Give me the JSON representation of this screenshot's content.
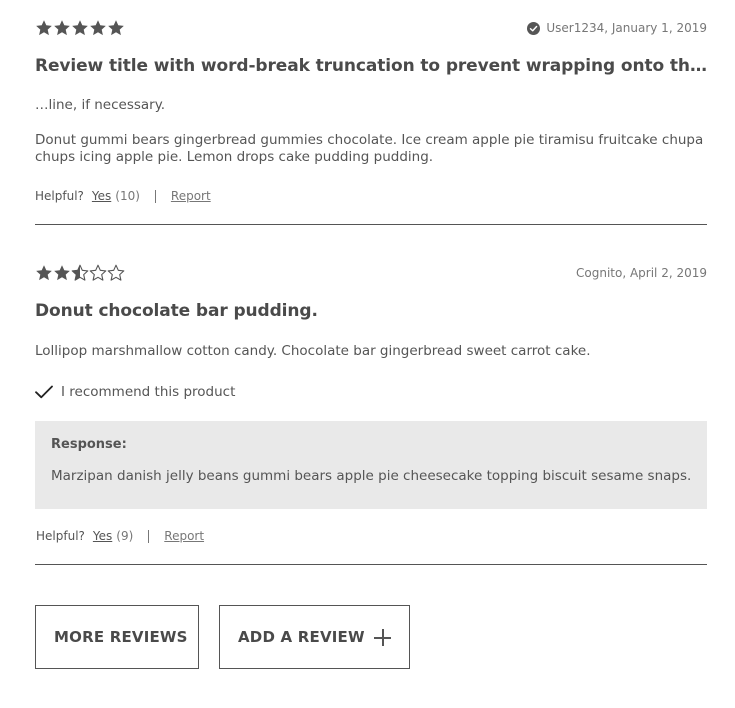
{
  "colors": {
    "text": "#555555",
    "border": "#555555",
    "response_bg": "#e9e9e9",
    "star": "#555555"
  },
  "reviews": [
    {
      "rating": 5,
      "verified": true,
      "verified_icon": "check-circle-icon",
      "meta": "User1234, January 1, 2019",
      "title": "Review title with word-break truncation to prevent wrapping onto the next…",
      "title_continuation": "…line, if necessary.",
      "body": "Donut gummi bears gingerbread gummies chocolate. Ice cream apple pie tiramisu fruitcake chupa chups icing apple pie. Lemon drops cake pudding pudding.",
      "helpful_label": "Helpful?",
      "yes_label": "Yes",
      "yes_count": "(10)",
      "report_label": "Report"
    },
    {
      "rating": 2.5,
      "meta": "Cognito, April 2, 2019",
      "title": "Donut chocolate bar pudding.",
      "body": "Lollipop marshmallow cotton candy. Chocolate bar gingerbread sweet carrot cake.",
      "recommend_icon": "checkmark-icon",
      "recommend_text": "I recommend this product",
      "response_label": "Response:",
      "response_text": "Marzipan danish jelly beans gummi bears apple pie cheesecake topping biscuit sesame snaps.",
      "helpful_label": "Helpful?",
      "yes_label": "Yes",
      "yes_count": "(9)",
      "report_label": "Report"
    }
  ],
  "buttons": {
    "more_reviews": "MORE REVIEWS",
    "add_review": "ADD A REVIEW",
    "add_icon": "plus-icon"
  }
}
